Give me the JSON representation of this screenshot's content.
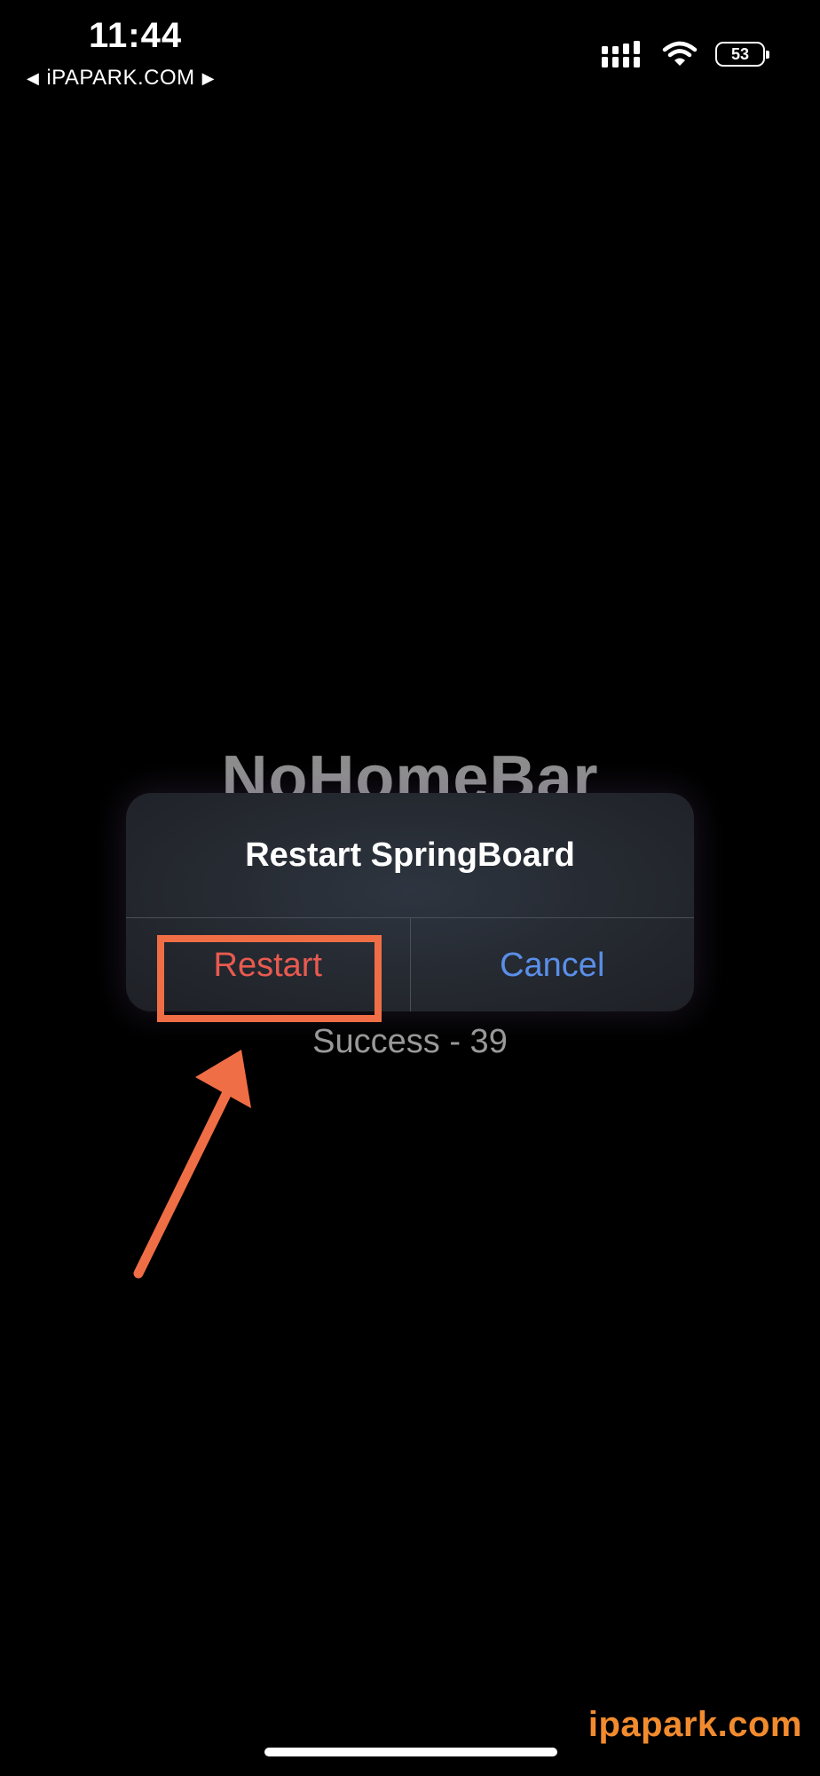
{
  "status_bar": {
    "time": "11:44",
    "carrier": "iPAPARK.COM",
    "battery": "53"
  },
  "app": {
    "title": "NoHomeBar",
    "status": "Success - 39"
  },
  "alert": {
    "title": "Restart SpringBoard",
    "restart_label": "Restart",
    "cancel_label": "Cancel"
  },
  "watermark": "ipapark.com",
  "colors": {
    "destructive": "#e95a4f",
    "action": "#5a8fe8",
    "annotation": "#f06e45",
    "watermark": "#f28b2e"
  },
  "icons": [
    "back-arrow-icon",
    "forward-arrow-icon",
    "cellular-signal-icon",
    "wifi-icon",
    "battery-icon",
    "annotation-arrow-icon"
  ]
}
